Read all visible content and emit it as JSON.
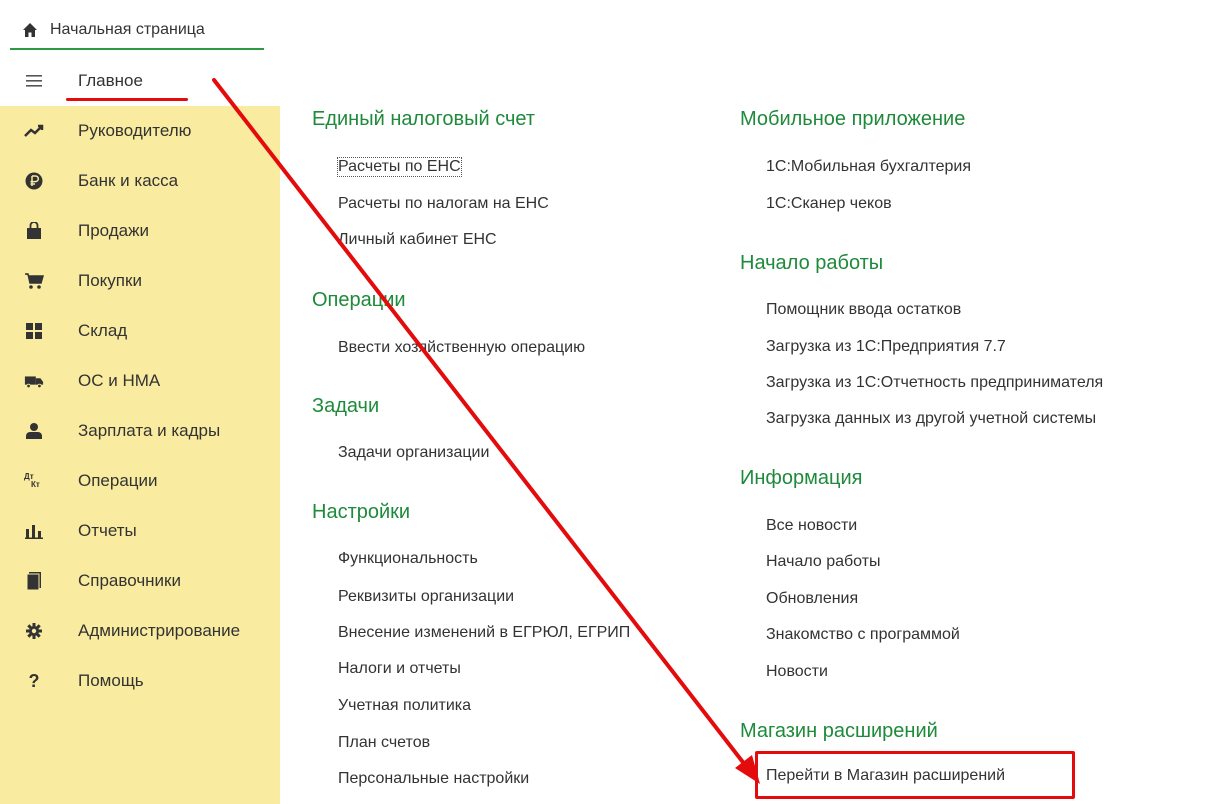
{
  "home": {
    "label": "Начальная страница",
    "icon": "home-icon"
  },
  "sidebar": {
    "items": [
      {
        "label": "Главное",
        "icon": "hamburger-icon"
      },
      {
        "label": "Руководителю",
        "icon": "trend-icon"
      },
      {
        "label": "Банк и касса",
        "icon": "ruble-icon"
      },
      {
        "label": "Продажи",
        "icon": "shopping-bag-icon"
      },
      {
        "label": "Покупки",
        "icon": "cart-icon"
      },
      {
        "label": "Склад",
        "icon": "warehouse-icon"
      },
      {
        "label": "ОС и НМА",
        "icon": "truck-icon"
      },
      {
        "label": "Зарплата и кадры",
        "icon": "person-icon"
      },
      {
        "label": "Операции",
        "icon": "dt-kt-icon"
      },
      {
        "label": "Отчеты",
        "icon": "bar-chart-icon"
      },
      {
        "label": "Справочники",
        "icon": "books-icon"
      },
      {
        "label": "Администрирование",
        "icon": "gear-icon"
      },
      {
        "label": "Помощь",
        "icon": "question-icon"
      }
    ],
    "dtkt_top": "Дт",
    "dtkt_bottom": "Кт",
    "help_glyph": "?"
  },
  "left": {
    "ens": {
      "title": "Единый налоговый счет",
      "links": [
        "Расчеты по ЕНС",
        "Расчеты по налогам на ЕНС",
        "Личный кабинет ЕНС"
      ]
    },
    "ops": {
      "title": "Операции",
      "links": [
        "Ввести хозяйственную операцию"
      ]
    },
    "tasks": {
      "title": "Задачи",
      "links": [
        "Задачи организации"
      ]
    },
    "settings": {
      "title": "Настройки",
      "links": [
        "Функциональность",
        "Реквизиты организации",
        "Внесение изменений в ЕГРЮЛ, ЕГРИП",
        "Налоги и отчеты",
        "Учетная политика",
        "План счетов",
        "Персональные настройки"
      ]
    }
  },
  "right": {
    "mobile": {
      "title": "Мобильное приложение",
      "links": [
        "1С:Мобильная бухгалтерия",
        "1С:Сканер чеков"
      ]
    },
    "start": {
      "title": "Начало работы",
      "links": [
        "Помощник ввода остатков",
        "Загрузка из 1С:Предприятия 7.7",
        "Загрузка из 1С:Отчетность предпринимателя",
        "Загрузка данных из другой учетной системы"
      ]
    },
    "info": {
      "title": "Информация",
      "links": [
        "Все новости",
        "Начало работы",
        "Обновления",
        "Знакомство с программой",
        "Новости"
      ]
    },
    "store": {
      "title": "Магазин расширений",
      "links": [
        "Перейти в Магазин расширений"
      ]
    }
  },
  "colors": {
    "accent_green": "#1e8a3a",
    "sidebar_bg": "#f9eca0",
    "annotation_red": "#e30b0b"
  }
}
